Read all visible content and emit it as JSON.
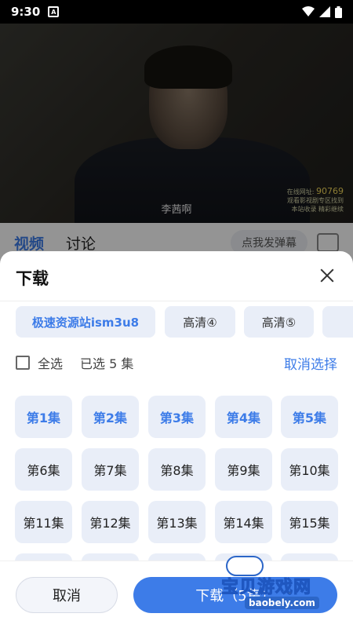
{
  "status_bar": {
    "time": "9:30",
    "notification_icon": "A"
  },
  "video": {
    "subtitle": "李茜啊",
    "watermark_lines": [
      "在线网址:",
      "90769",
      "观看影视剧专区找到",
      "本站收录",
      "精彩继续"
    ]
  },
  "tabs": {
    "video_label": "视频",
    "discuss_label": "讨论",
    "danmaku_label": "点我发弹幕"
  },
  "sheet": {
    "title": "下载",
    "sources": [
      "极速资源站ism3u8",
      "高清④",
      "高清⑤",
      ""
    ],
    "select_all_label": "全选",
    "selected_count_text": "已选 5 集",
    "cancel_selection_label": "取消选择",
    "episodes": [
      {
        "label": "第1集",
        "selected": true
      },
      {
        "label": "第2集",
        "selected": true
      },
      {
        "label": "第3集",
        "selected": true
      },
      {
        "label": "第4集",
        "selected": true
      },
      {
        "label": "第5集",
        "selected": true
      },
      {
        "label": "第6集",
        "selected": false
      },
      {
        "label": "第7集",
        "selected": false
      },
      {
        "label": "第8集",
        "selected": false
      },
      {
        "label": "第9集",
        "selected": false
      },
      {
        "label": "第10集",
        "selected": false
      },
      {
        "label": "第11集",
        "selected": false
      },
      {
        "label": "第12集",
        "selected": false
      },
      {
        "label": "第13集",
        "selected": false
      },
      {
        "label": "第14集",
        "selected": false
      },
      {
        "label": "第15集",
        "selected": false
      }
    ],
    "cancel_button": "取消",
    "download_button": "下载（5集）"
  },
  "site_watermark": {
    "brand": "宝贝游戏网",
    "domain": "baobely.com"
  },
  "colors": {
    "accent": "#3d7ce8",
    "chip_bg": "#e9eef8"
  }
}
